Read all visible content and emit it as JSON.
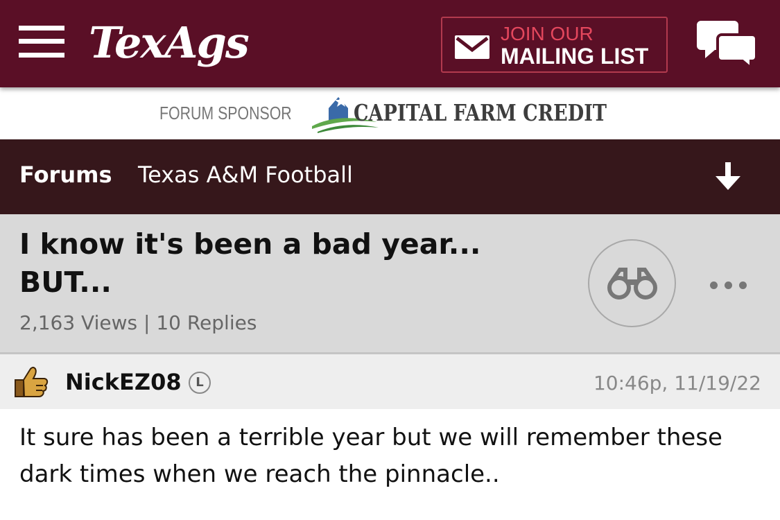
{
  "header": {
    "logo": "TexAgs",
    "mailing_line1": "JOIN OUR",
    "mailing_line2": "MAILING LIST",
    "colors": {
      "brand": "#5a0f26",
      "accent": "#e4475d"
    },
    "icons": [
      "menu-icon",
      "mail-icon",
      "chat-bubbles-icon"
    ]
  },
  "sponsor": {
    "label": "FORUM SPONSOR",
    "name": "CAPITAL FARM CREDIT"
  },
  "nav": {
    "forums": "Forums",
    "board": "Texas A&M Football",
    "icon": "arrow-down-icon"
  },
  "thread": {
    "title": "I know it's been a bad year... BUT...",
    "stats": "2,163 Views | 10 Replies",
    "icons": [
      "binoculars-icon",
      "more-icon"
    ]
  },
  "post": {
    "username": "NickEZ08",
    "badge": "L",
    "timestamp": "10:46p, 11/19/22",
    "body": "It sure has been a terrible year but we will remember these dark times when we reach the pinnacle.."
  }
}
